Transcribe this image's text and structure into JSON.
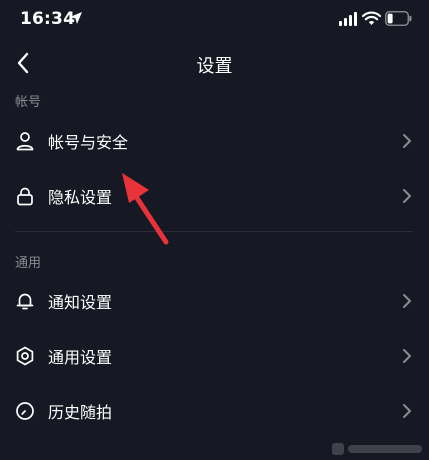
{
  "status_bar": {
    "time": "16:34",
    "icons": [
      "location-arrow-icon",
      "signal-icon",
      "wifi-icon",
      "battery-icon"
    ]
  },
  "nav": {
    "title": "设置",
    "back_icon": "back-chevron-icon"
  },
  "sections": [
    {
      "header": "帐号",
      "items": [
        {
          "label": "帐号与安全",
          "icon": "person-icon"
        },
        {
          "label": "隐私设置",
          "icon": "lock-icon"
        }
      ]
    },
    {
      "header": "通用",
      "items": [
        {
          "label": "通知设置",
          "icon": "bell-icon"
        },
        {
          "label": "通用设置",
          "icon": "gear-icon"
        },
        {
          "label": "历史随拍",
          "icon": "clock-icon"
        }
      ]
    }
  ],
  "colors": {
    "background": "#161823",
    "text": "#ffffff",
    "secondary_text": "#8a8b91",
    "chevron": "#8a8b91",
    "annotation_arrow": "#e8333a"
  }
}
